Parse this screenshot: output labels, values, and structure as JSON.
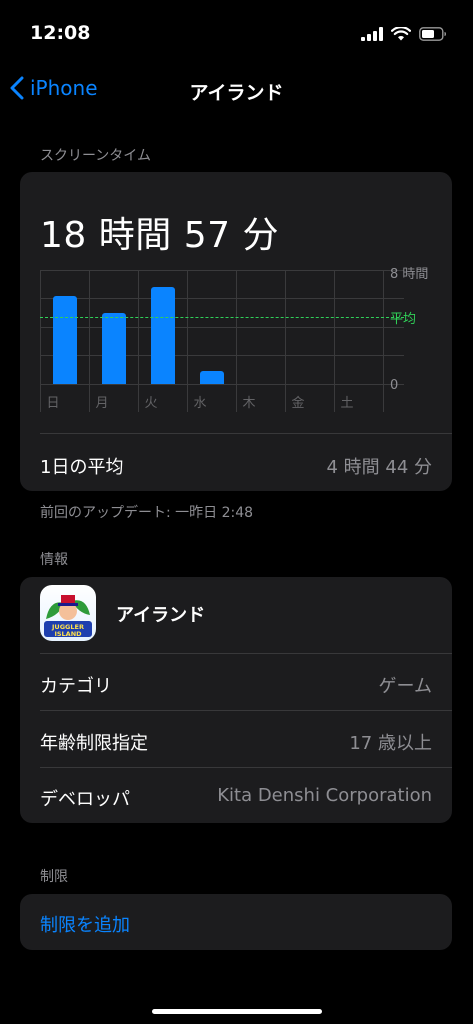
{
  "status": {
    "time": "12:08"
  },
  "nav": {
    "back_label": "iPhone",
    "title": "アイランド"
  },
  "screen_time": {
    "section_title": "スクリーンタイム",
    "total": "18 時間 57 分",
    "y_max_label": "8 時間",
    "y_min_label": "0",
    "avg_label": "平均",
    "days": [
      "日",
      "月",
      "火",
      "水",
      "木",
      "金",
      "土"
    ],
    "avg_row_label": "1日の平均",
    "avg_row_value": "4 時間 44 分",
    "accent_color": "#0a84ff",
    "avg_color": "#30d158"
  },
  "chart_data": {
    "type": "bar",
    "categories": [
      "日",
      "月",
      "火",
      "水",
      "木",
      "金",
      "土"
    ],
    "values": [
      6.2,
      5.0,
      6.8,
      0.9,
      0,
      0,
      0
    ],
    "average": 4.7,
    "ylim": [
      0,
      8
    ],
    "unit": "時間"
  },
  "last_update": "前回のアップデート: 一昨日 2:48",
  "info": {
    "section_title": "情報",
    "app_name": "アイランド",
    "app_icon_text": "JUGGLER ISLAND",
    "rows": [
      {
        "label": "カテゴリ",
        "value": "ゲーム"
      },
      {
        "label": "年齢制限指定",
        "value": "17 歳以上"
      },
      {
        "label": "デベロッパ",
        "value": "Kita Denshi Corporation"
      }
    ]
  },
  "limits": {
    "section_title": "制限",
    "add_label": "制限を追加"
  }
}
